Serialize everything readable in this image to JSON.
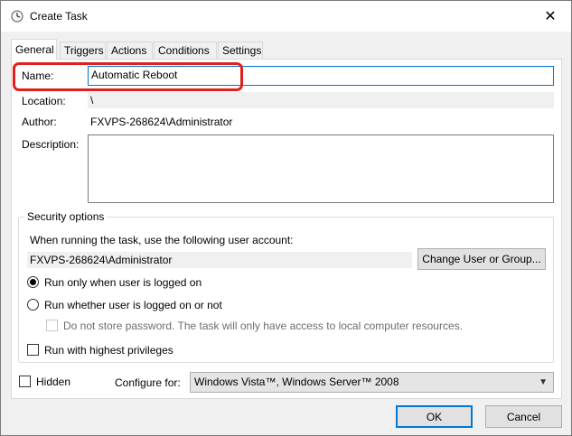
{
  "window": {
    "title": "Create Task",
    "title_icon": "task-clock-icon",
    "close_glyph": "✕"
  },
  "tabs": [
    {
      "label": "General",
      "active": true
    },
    {
      "label": "Triggers",
      "active": false
    },
    {
      "label": "Actions",
      "active": false
    },
    {
      "label": "Conditions",
      "active": false
    },
    {
      "label": "Settings",
      "active": false
    }
  ],
  "general": {
    "name_label": "Name:",
    "name_value": "Automatic Reboot",
    "location_label": "Location:",
    "location_value": "\\",
    "author_label": "Author:",
    "author_value": "FXVPS-268624\\Administrator",
    "description_label": "Description:",
    "description_value": ""
  },
  "security": {
    "title": "Security options",
    "account_prompt": "When running the task, use the following user account:",
    "account_value": "FXVPS-268624\\Administrator",
    "change_button": "Change User or Group...",
    "radio_logged_on": "Run only when user is logged on",
    "radio_whether": "Run whether user is logged on or not",
    "do_not_store": "Do not store password.  The task will only have access to local computer resources.",
    "highest_privileges": "Run with highest privileges"
  },
  "footer": {
    "hidden_label": "Hidden",
    "configure_label": "Configure for:",
    "configure_value": "Windows Vista™, Windows Server™ 2008",
    "ok_button": "OK",
    "cancel_button": "Cancel"
  },
  "colors": {
    "highlight": "#e0201b",
    "focus": "#0078d7"
  }
}
